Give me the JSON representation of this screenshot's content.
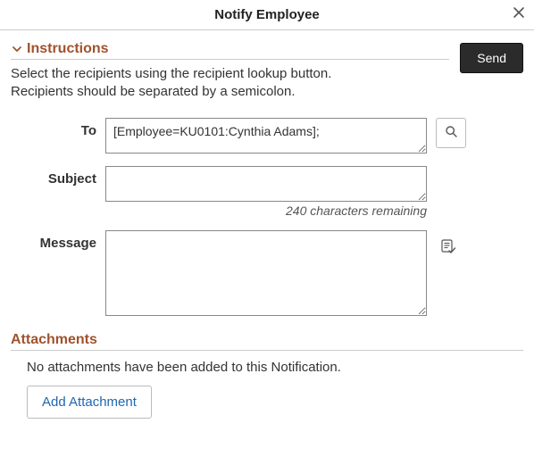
{
  "dialog": {
    "title": "Notify Employee"
  },
  "instructions": {
    "heading": "Instructions",
    "line1": "Select the recipients using the recipient lookup button.",
    "line2": "Recipients should be separated by a semicolon."
  },
  "buttons": {
    "send": "Send",
    "add_attachment": "Add Attachment"
  },
  "fields": {
    "to": {
      "label": "To",
      "value": "[Employee=KU0101:Cynthia Adams];"
    },
    "subject": {
      "label": "Subject",
      "value": "",
      "chars_remaining": "240 characters remaining"
    },
    "message": {
      "label": "Message",
      "value": ""
    }
  },
  "attachments": {
    "heading": "Attachments",
    "empty_message": "No attachments have been added to this Notification."
  }
}
